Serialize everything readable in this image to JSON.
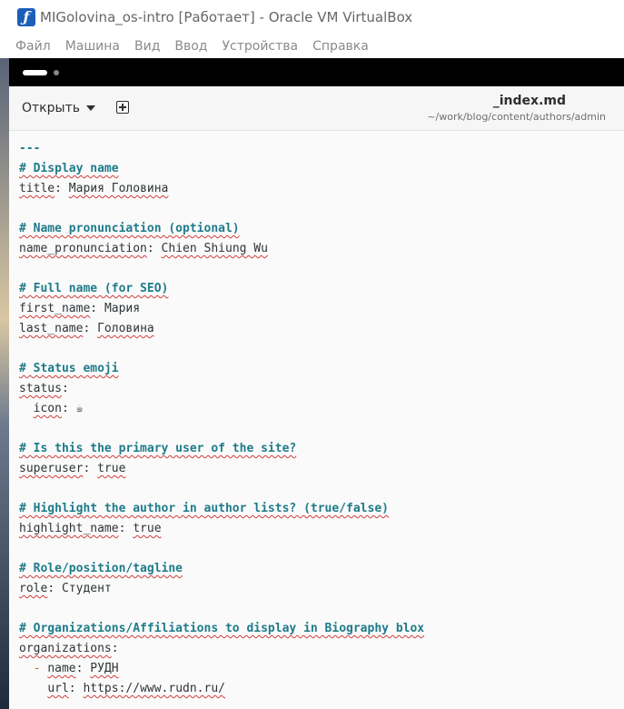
{
  "window": {
    "title": "MIGolovina_os-intro [Работает] - Oracle VM VirtualBox"
  },
  "menu": [
    "Файл",
    "Машина",
    "Вид",
    "Ввод",
    "Устройства",
    "Справка"
  ],
  "editor_header": {
    "open_label": "Открыть",
    "doc_title": "_index.md",
    "doc_path": "~/work/blog/content/authors/admin"
  },
  "lines": {
    "l0": "---",
    "c1": "# Display name",
    "k1": "title",
    "v1": "Мария Головина",
    "c2": "# Name pronunciation (optional)",
    "k2": "name_pronunciation",
    "v2": "Chien Shiung Wu",
    "c3": "# Full name (for SEO)",
    "k3a": "first_name",
    "v3a": "Мария",
    "k3b": "last_name",
    "v3b": "Головина",
    "c4": "# Status emoji",
    "k4": "status",
    "k4b": "icon",
    "v4b": "☕",
    "c5": "# Is this the primary user of the site?",
    "k5": "superuser",
    "v5": "true",
    "c6": "# Highlight the author in author lists? (true/false)",
    "k6": "highlight_name",
    "v6": "true",
    "c7": "# Role/position/tagline",
    "k7": "role",
    "v7": "Студент",
    "c8": "# Organizations/Affiliations to display in Biography blox",
    "k8": "organizations",
    "dash": "-",
    "k8a": "name",
    "v8a": "РУДН",
    "k8b": "url",
    "v8b": "https://www.rudn.ru/"
  }
}
